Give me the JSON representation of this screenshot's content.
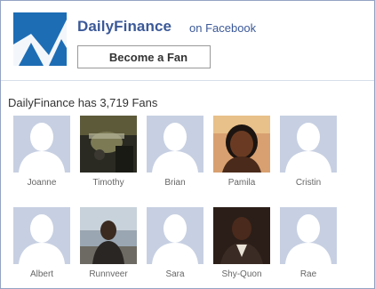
{
  "header": {
    "page_name": "DailyFinance",
    "suffix": "on Facebook",
    "fan_button_label": "Become a Fan"
  },
  "fan_count_text": "DailyFinance has 3,719 Fans",
  "fans": [
    {
      "name": "Joanne",
      "photo": "silhouette"
    },
    {
      "name": "Timothy",
      "photo": "photo"
    },
    {
      "name": "Brian",
      "photo": "silhouette"
    },
    {
      "name": "Pamila",
      "photo": "photo"
    },
    {
      "name": "Cristin",
      "photo": "silhouette"
    },
    {
      "name": "Albert",
      "photo": "silhouette"
    },
    {
      "name": "Runnveer",
      "photo": "photo"
    },
    {
      "name": "Sara",
      "photo": "silhouette"
    },
    {
      "name": "Shy-Quon",
      "photo": "photo"
    },
    {
      "name": "Rae",
      "photo": "silhouette"
    }
  ],
  "colors": {
    "brand_blue": "#3b5998",
    "logo_blue": "#1d6db5",
    "border": "#94a3c4",
    "silhouette_bg": "#c7d0e2"
  }
}
